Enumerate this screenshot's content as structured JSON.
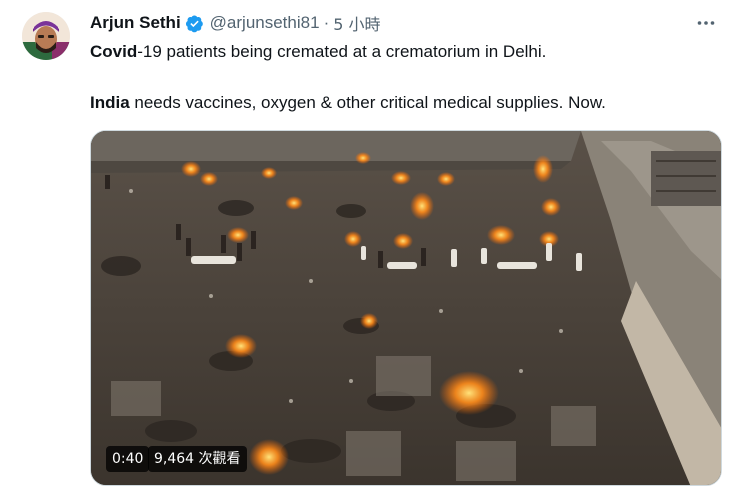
{
  "author": {
    "display_name": "Arjun Sethi",
    "handle": "@arjunsethi81",
    "separator": "·",
    "timestamp": "5 小時",
    "verified": true
  },
  "tweet": {
    "line1_bold": "Covid",
    "line1_rest": "-19 patients being cremated at a crematorium in Delhi.",
    "line2_bold": "India",
    "line2_rest": " needs vaccines, oxygen & other critical medical supplies. Now."
  },
  "media": {
    "duration": "0:40",
    "views": "9,464 次觀看"
  },
  "icons": {
    "verified": "verified-badge-icon",
    "more": "more-horizontal-icon"
  },
  "colors": {
    "verified_blue": "#1d9bf0",
    "secondary_text": "#536471",
    "primary_text": "#0f1419",
    "fire": "#ff9a1a"
  }
}
